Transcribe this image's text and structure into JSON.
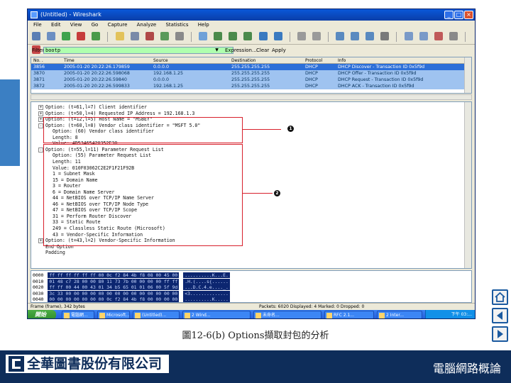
{
  "window": {
    "title": "(Untitled) - Wireshark",
    "buttons": [
      "_",
      "□",
      "×"
    ]
  },
  "menu": [
    "File",
    "Edit",
    "View",
    "Go",
    "Capture",
    "Analyze",
    "Statistics",
    "Help"
  ],
  "filter": {
    "label": "Filter:",
    "value": "bootp",
    "expression_label": "Expression...",
    "clear_label": "Clear",
    "apply_label": "Apply"
  },
  "packet_list": {
    "columns": [
      "No. .",
      "Time",
      "Source",
      "Destination",
      "Protocol",
      "Info"
    ],
    "rows": [
      [
        "3856",
        "2005-01-20 20:22:26.179859",
        "0.0.0.0",
        "255.255.255.255",
        "DHCP",
        "DHCP Discover - Transaction ID 0x5f9d"
      ],
      [
        "3870",
        "2005-01-20 20:22:26.598068",
        "192.168.1.25",
        "255.255.255.255",
        "DHCP",
        "DHCP Offer    - Transaction ID 0x5f9d"
      ],
      [
        "3871",
        "2005-01-20 20:22:26.59840",
        "0.0.0.0",
        "255.255.255.255",
        "DHCP",
        "DHCP Request  - Transaction ID 0x5f9d"
      ],
      [
        "3872",
        "2005-01-20 20:22:26.599833",
        "192.168.1.25",
        "255.255.255.255",
        "DHCP",
        "DHCP ACK      - Transaction ID 0x5f9d"
      ]
    ]
  },
  "detail": {
    "lines": [
      {
        "toggle": "+",
        "indent": 0,
        "text": "Option: (t=61,l=7) Client identifier"
      },
      {
        "toggle": "+",
        "indent": 0,
        "text": "Option: (t=50,l=4) Requested IP Address = 192.168.1.3"
      },
      {
        "toggle": "+",
        "indent": 0,
        "text": "Option: (t=12,l=5) Host Name = \"MSBEY\""
      },
      {
        "toggle": "-",
        "indent": 0,
        "text": "Option: (t=60,l=8) Vendor class identifier = \"MSFT 5.0\""
      },
      {
        "toggle": "",
        "indent": 1,
        "text": "Option: (60) Vendor class identifier"
      },
      {
        "toggle": "",
        "indent": 1,
        "text": "Length: 8"
      },
      {
        "toggle": "",
        "indent": 1,
        "text": "Value: 4D53465420352E30"
      },
      {
        "toggle": "-",
        "indent": 0,
        "text": "Option: (t=55,l=11) Parameter Request List"
      },
      {
        "toggle": "",
        "indent": 1,
        "text": "Option: (55) Parameter Request List"
      },
      {
        "toggle": "",
        "indent": 1,
        "text": "Length: 11"
      },
      {
        "toggle": "",
        "indent": 1,
        "text": "Value: 010F03062C2E2F1F21F92B"
      },
      {
        "toggle": "",
        "indent": 1,
        "text": "1 = Subnet Mask"
      },
      {
        "toggle": "",
        "indent": 1,
        "text": "15 = Domain Name"
      },
      {
        "toggle": "",
        "indent": 1,
        "text": "3 = Router"
      },
      {
        "toggle": "",
        "indent": 1,
        "text": "6 = Domain Name Server"
      },
      {
        "toggle": "",
        "indent": 1,
        "text": "44 = NetBIOS over TCP/IP Name Server"
      },
      {
        "toggle": "",
        "indent": 1,
        "text": "46 = NetBIOS over TCP/IP Node Type"
      },
      {
        "toggle": "",
        "indent": 1,
        "text": "47 = NetBIOS over TCP/IP Scope"
      },
      {
        "toggle": "",
        "indent": 1,
        "text": "31 = Perform Router Discover"
      },
      {
        "toggle": "",
        "indent": 1,
        "text": "33 = Static Route"
      },
      {
        "toggle": "",
        "indent": 1,
        "text": "249 = Classless Static Route (Microsoft)"
      },
      {
        "toggle": "",
        "indent": 1,
        "text": "43 = Vendor-Specific Information"
      },
      {
        "toggle": "+",
        "indent": 0,
        "text": "Option: (t=43,l=2) Vendor-Specific Information"
      },
      {
        "toggle": "",
        "indent": 0,
        "text": "End Option"
      },
      {
        "toggle": "",
        "indent": 0,
        "text": "Padding"
      }
    ],
    "markers": [
      "1",
      "2"
    ]
  },
  "hex": {
    "lines": [
      {
        "offset": "0000",
        "bytes": "ff ff ff ff ff ff 00 0c  f2 84 4b f8 08 00 45 00",
        "ascii": "..........K...E."
      },
      {
        "offset": "0010",
        "bytes": "01 48 c7 28 00 00 80 11  73 7b 00 00 00 00 ff ff",
        "ascii": ".H.(....s{......"
      },
      {
        "offset": "0020",
        "bytes": "ff ff 00 44 00 43 01 34  b5 65 01 01 06 00 5f 9d",
        "ascii": "...D.C.4.e...._."
      },
      {
        "offset": "0030",
        "bytes": "3c 33 00 00 00 00 00 00  00 00 00 00 00 00 00 00",
        "ascii": "<3.............."
      },
      {
        "offset": "0040",
        "bytes": "00 00 00 00 00 00 00 0c  f2 84 4b f8 00 00 00 00",
        "ascii": "..........K....."
      }
    ]
  },
  "statusbar": {
    "left": "Frame (frame), 342 bytes",
    "right": "Packets: 6020 Displayed: 4 Marked: 0 Dropped: 0"
  },
  "taskbar": {
    "start": "開始",
    "tasks": [
      "電腦網...",
      "Microsoft...",
      "(Untitled)...",
      "2 Wind...",
      "未命名...",
      "RFC 2.1...",
      "2 Inter..."
    ],
    "clock": "下午 03:..."
  },
  "caption": "圖12-6(b) Options擷取封包的分析",
  "footer": {
    "company": "全華圖書股份有限公司",
    "course": "電腦網路概論"
  },
  "colors": {
    "selected_row": "#2c6fd8",
    "highlight": "#d8202c",
    "footer_bg": "#0e2d5a",
    "filter_ok": "#afffaf"
  }
}
